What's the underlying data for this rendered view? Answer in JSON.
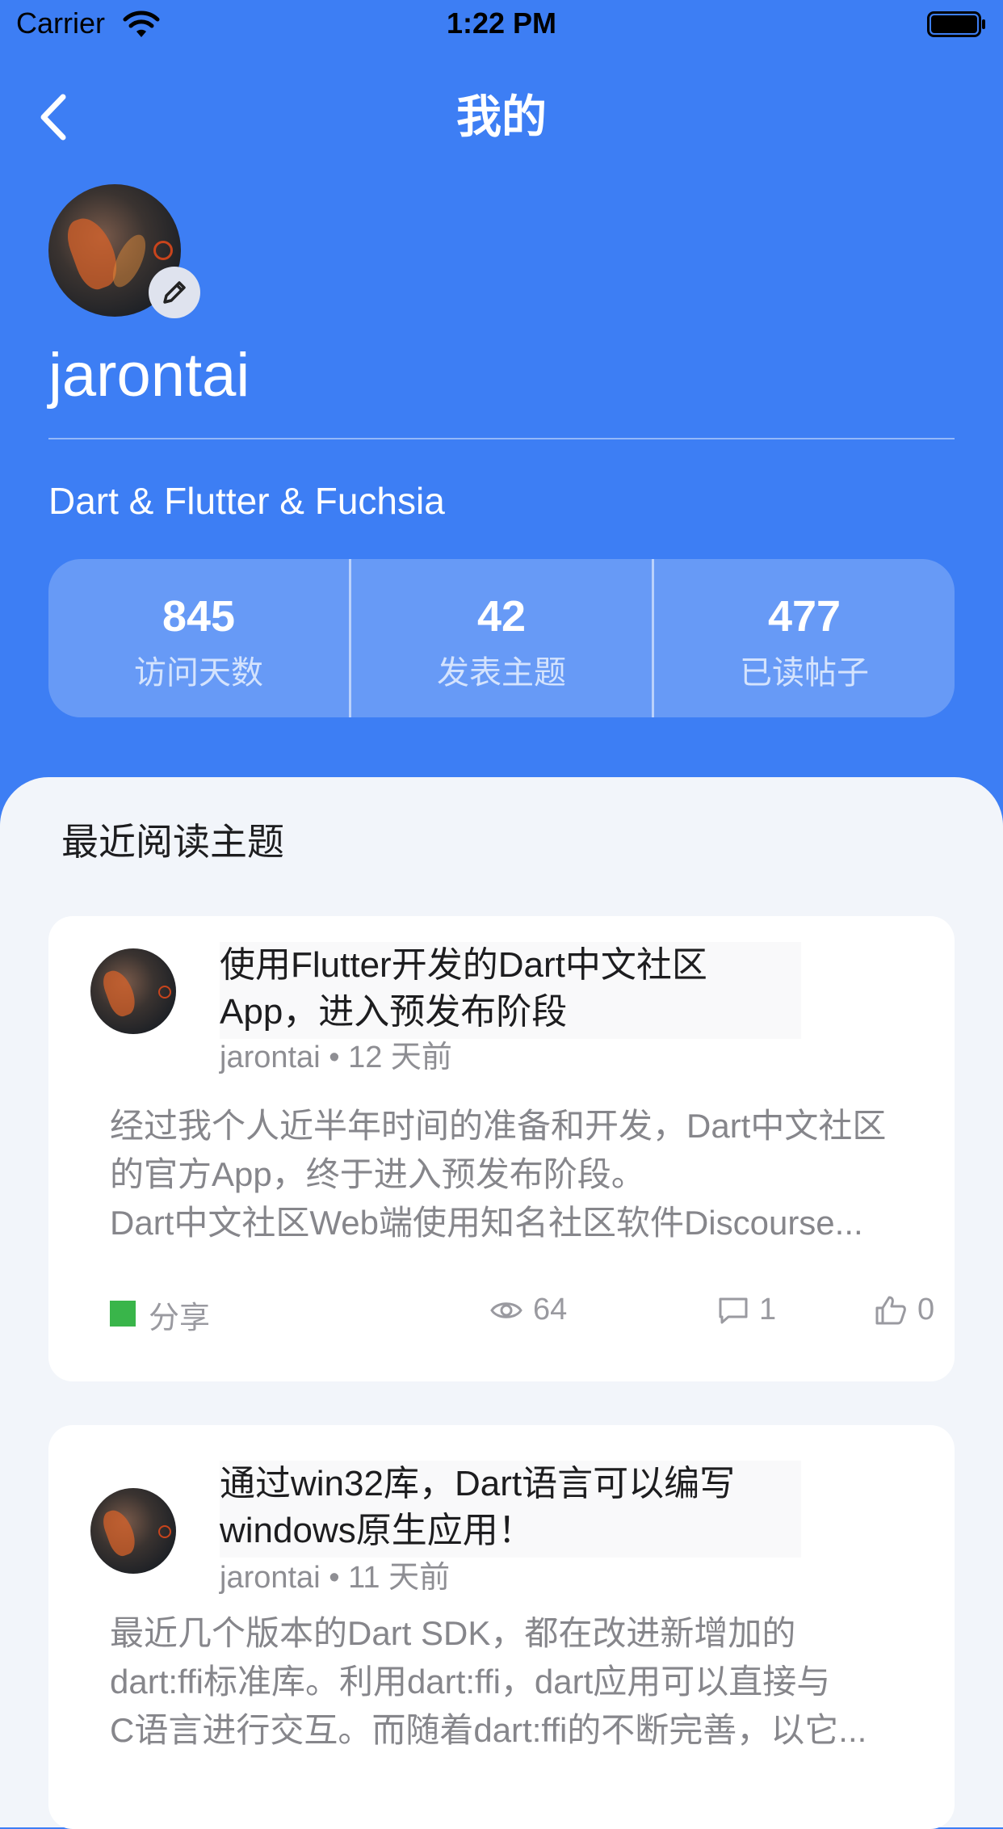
{
  "status_bar": {
    "carrier": "Carrier",
    "time": "1:22 PM"
  },
  "nav": {
    "title": "我的"
  },
  "profile": {
    "username": "jarontai",
    "bio": "Dart & Flutter & Fuchsia",
    "stats": [
      {
        "value": "845",
        "label": "访问天数"
      },
      {
        "value": "42",
        "label": "发表主题"
      },
      {
        "value": "477",
        "label": "已读帖子"
      }
    ]
  },
  "recent": {
    "title": "最近阅读主题",
    "topics": [
      {
        "title_line1": "使用Flutter开发的Dart中文社区",
        "title_line2": "App，进入预发布阶段",
        "author": "jarontai",
        "time": "12 天前",
        "excerpt_lines": [
          "经过我个人近半年时间的准备和开发，Dart中文社区",
          "的官方App，终于进入预发布阶段。",
          "Dart中文社区Web端使用知名社区软件Discourse..."
        ],
        "category": "分享",
        "category_color": "#39b54a",
        "views": "64",
        "replies": "1",
        "likes": "0"
      },
      {
        "title_line1": "通过win32库，Dart语言可以编写",
        "title_line2": "windows原生应用！",
        "author": "jarontai",
        "time": "11 天前",
        "excerpt_lines": [
          "最近几个版本的Dart SDK，都在改进新增加的",
          "dart:ffi标准库。利用dart:ffi，dart应用可以直接与",
          "C语言进行交互。而随着dart:ffi的不断完善，以它..."
        ]
      }
    ]
  },
  "colors": {
    "header_bg": "#3d7ef4",
    "sheet_bg": "#f2f5fa",
    "accent_green": "#39b54a"
  }
}
